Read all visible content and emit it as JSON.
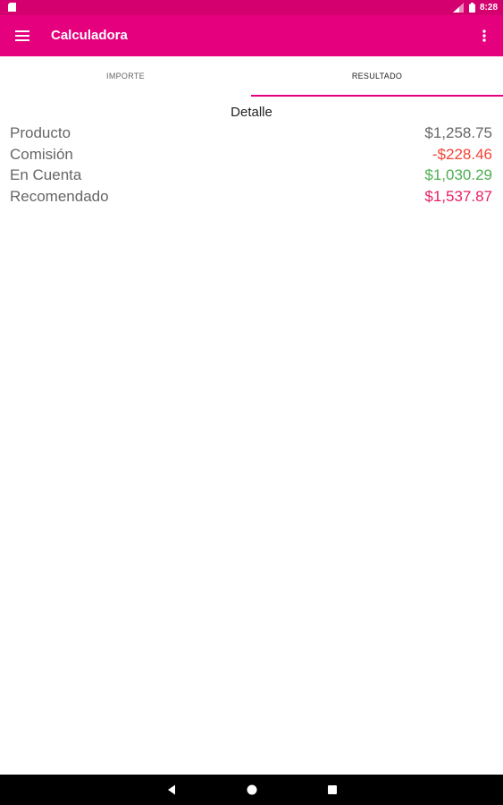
{
  "status_bar": {
    "time": "8:28"
  },
  "app_bar": {
    "title": "Calculadora"
  },
  "tabs": [
    {
      "label": "IMPORTE",
      "selected": false
    },
    {
      "label": "RESULTADO",
      "selected": true
    }
  ],
  "detail": {
    "title": "Detalle",
    "rows": [
      {
        "label": "Producto",
        "value": "$1,258.75",
        "color": "#666666"
      },
      {
        "label": "Comisión",
        "value": "-$228.46",
        "color": "#f44336"
      },
      {
        "label": "En Cuenta",
        "value": "$1,030.29",
        "color": "#4caf50"
      },
      {
        "label": "Recomendado",
        "value": "$1,537.87",
        "color": "#e91e63"
      }
    ]
  },
  "colors": {
    "primary": "#e5007e",
    "primary_dark": "#d4006f"
  },
  "icons": [
    "sd-card-icon",
    "signal-icon",
    "battery-icon",
    "menu-icon",
    "more-vert-icon",
    "back-icon",
    "home-icon",
    "recents-icon"
  ]
}
